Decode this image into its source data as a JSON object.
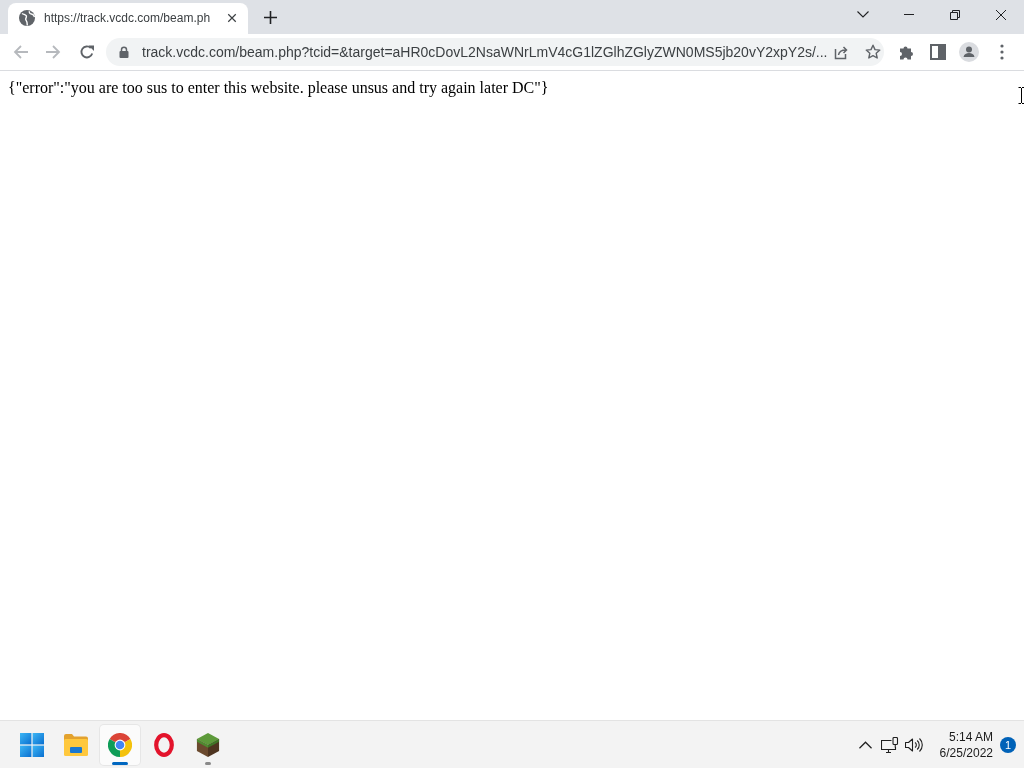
{
  "browser": {
    "tabs": [
      {
        "title": "https://track.vcdc.com/beam.ph",
        "selected": true
      }
    ],
    "navigation": {
      "back": {
        "disabled": true
      },
      "forward": {
        "disabled": true
      }
    },
    "address_bar": {
      "url": "track.vcdc.com/beam.php?tcid=&target=aHR0cDovL2NsaWNrLmV4cG1lZGlhZGlyZWN0MS5jb20vY2xpY2s/..."
    }
  },
  "page": {
    "body_text": "{\"error\":\"you are too sus to enter this website. please unsus and try again later DC\"}"
  },
  "taskbar": {
    "apps": [
      {
        "kind": "start",
        "selected": false,
        "running": false
      },
      {
        "kind": "file_explorer",
        "selected": false,
        "running": false
      },
      {
        "kind": "chrome",
        "selected": true,
        "running": true
      },
      {
        "kind": "opera",
        "selected": false,
        "running": false
      },
      {
        "kind": "grass_block",
        "selected": false,
        "running": true
      }
    ],
    "clock": {
      "time": "5:14 AM",
      "date": "6/25/2022"
    },
    "notification_count": "1"
  }
}
